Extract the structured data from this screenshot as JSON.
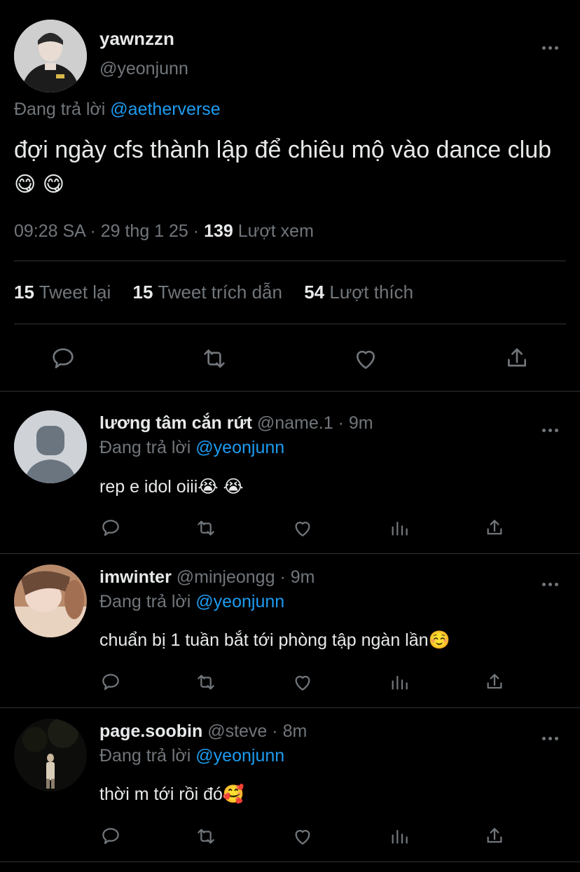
{
  "main_tweet": {
    "display_name": "yawnzzn",
    "handle": "@yeonjunn",
    "replying_prefix": "Đang trả lời",
    "replying_to": "@aetherverse",
    "text": "đợi ngày cfs thành lập để chiêu mộ vào dance club",
    "emojis": [
      "😋",
      "😋"
    ],
    "time": "09:28 SA",
    "date": "29 thg 1 25",
    "separator": "·",
    "views_count": "139",
    "views_label": "Lượt xem",
    "stats": {
      "retweets_count": "15",
      "retweets_label": "Tweet lại",
      "quotes_count": "15",
      "quotes_label": "Tweet trích dẫn",
      "likes_count": "54",
      "likes_label": "Lượt thích"
    }
  },
  "replies": [
    {
      "display_name": "lương tâm cắn rứt",
      "handle": "@name.1",
      "time": "9m",
      "replying_prefix": "Đang trả lời",
      "replying_to": "@yeonjunn",
      "text": "rep e idol oiii",
      "emojis": [
        "😭",
        "😭"
      ]
    },
    {
      "display_name": "imwinter",
      "handle": "@minjeongg",
      "time": "9m",
      "replying_prefix": "Đang trả lời",
      "replying_to": "@yeonjunn",
      "text": "chuẩn bị 1 tuần bắt tới phòng tập ngàn lần",
      "emojis": [
        "☺️"
      ]
    },
    {
      "display_name": "page.soobin",
      "handle": "@steve",
      "time": "8m",
      "replying_prefix": "Đang trả lời",
      "replying_to": "@yeonjunn",
      "text": "thời m tới rồi đó",
      "emojis": [
        "🥰"
      ]
    }
  ],
  "colors": {
    "background": "#000000",
    "text": "#e7e9ea",
    "muted": "#71767b",
    "link": "#1d9bf0",
    "divider": "#2f3336"
  }
}
